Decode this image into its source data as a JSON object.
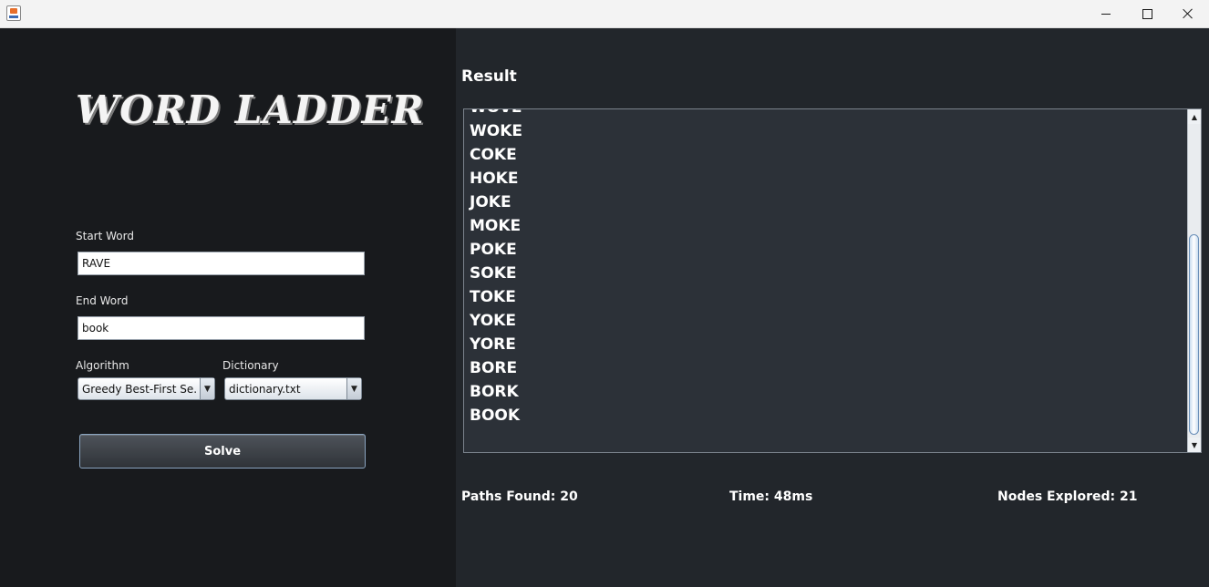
{
  "window": {
    "app_icon": "java-icon",
    "controls": [
      "minimize-icon",
      "maximize-icon",
      "close-icon"
    ]
  },
  "app": {
    "title": "WORD LADDER"
  },
  "form": {
    "start_word_label": "Start Word",
    "start_word_value": "RAVE",
    "end_word_label": "End Word",
    "end_word_value": "book",
    "algorithm_label": "Algorithm",
    "algorithm_selected": "Greedy Best-First Se...",
    "dictionary_label": "Dictionary",
    "dictionary_selected": "dictionary.txt",
    "solve_label": "Solve"
  },
  "result": {
    "heading": "Result",
    "items": [
      "WOVE",
      "WOKE",
      "COKE",
      "HOKE",
      "JOKE",
      "MOKE",
      "POKE",
      "SOKE",
      "TOKE",
      "YOKE",
      "YORE",
      "BORE",
      "BORK",
      "BOOK"
    ]
  },
  "stats": {
    "paths_found": "Paths Found: 20",
    "time": "Time: 48ms",
    "nodes_explored": "Nodes Explored: 21"
  },
  "colors": {
    "left_panel_bg": "#181a1d",
    "right_panel_bg": "#22262b",
    "result_box_bg": "#2c3138",
    "text": "#ffffff",
    "button_border": "#8aa5c0"
  }
}
